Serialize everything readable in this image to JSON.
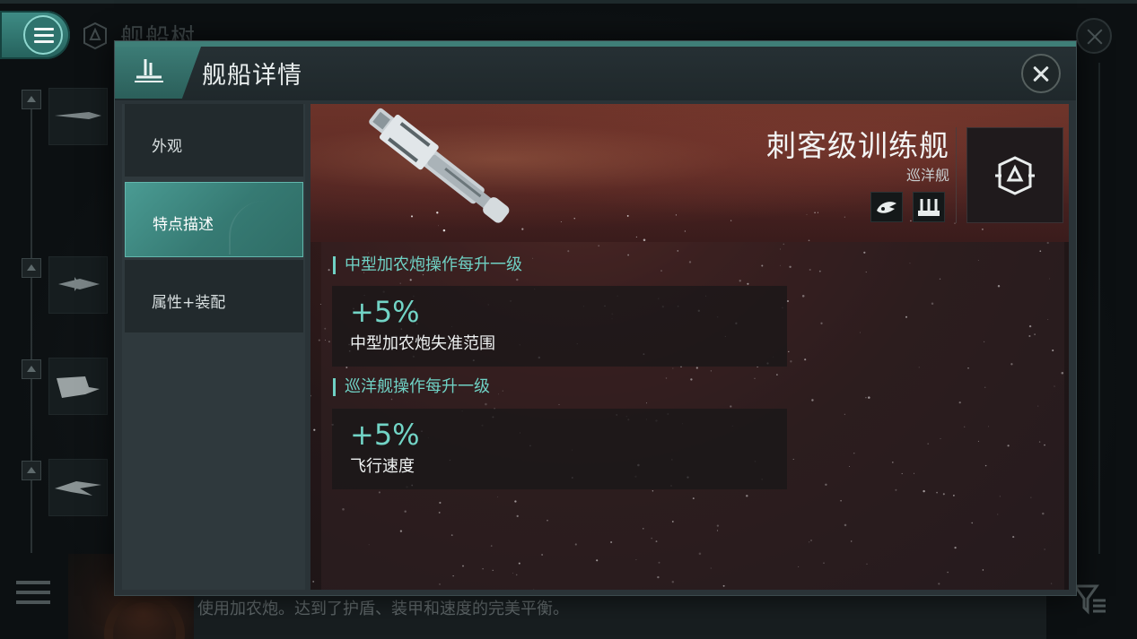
{
  "background": {
    "title": "舰船树",
    "description": "使用加农炮。达到了护盾、装甲和速度的完美平衡。"
  },
  "modal": {
    "title": "舰船详情",
    "nav": [
      {
        "label": "外观",
        "active": false
      },
      {
        "label": "特点描述",
        "active": true
      },
      {
        "label": "属性+装配",
        "active": false
      }
    ],
    "ship": {
      "name": "刺客级训练舰",
      "class": "巡洋舰",
      "role_icons": [
        "drone-role-icon",
        "turret-role-icon"
      ],
      "faction_icon": "faction-emblem-icon"
    },
    "traits": [
      {
        "header": "中型加农炮操作每升一级",
        "bonus_value": "+5%",
        "bonus_desc": "中型加农炮失准范围"
      },
      {
        "header": "巡洋舰操作每升一级",
        "bonus_value": "+5%",
        "bonus_desc": "飞行速度"
      }
    ]
  },
  "colors": {
    "accent": "#6fd1c4",
    "nav_active": "#3f8d86",
    "panel": "#2a3337"
  }
}
